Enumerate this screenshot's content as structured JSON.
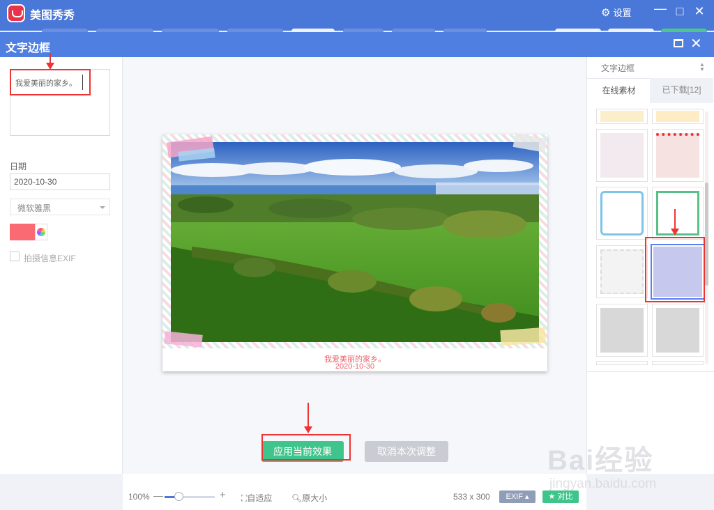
{
  "app": {
    "title": "美图秀秀",
    "settings_label": "设置"
  },
  "dialog": {
    "title": "文字边框"
  },
  "left_panel": {
    "text_value": "我爱美丽的家乡。",
    "date_label": "日期",
    "date_value": "2020-10-30",
    "font_value": "微软雅黑",
    "text_color": "#f96a73",
    "exif_checkbox_label": "拍摄信息EXIF"
  },
  "preview": {
    "caption_text": "我爱美丽的家乡。",
    "caption_date": "2020-10-30"
  },
  "actions": {
    "apply_label": "应用当前效果",
    "cancel_label": "取消本次调整"
  },
  "right_panel": {
    "category": "文字边框",
    "tabs": [
      {
        "label": "在线素材",
        "active": true
      },
      {
        "label": "已下载[12]",
        "active": false
      }
    ]
  },
  "bottom_bar": {
    "zoom": "100%",
    "fit_label": "自适应",
    "original_label": "原大小",
    "image_size": "533 x 300",
    "exif_label": "EXIF",
    "compare_label": "对比"
  },
  "watermark": {
    "brand": "Bai经验",
    "url": "jingyan.baidu.com"
  },
  "colors": {
    "titlebar": "#4a78d8",
    "dialog_header": "#4f7fe0",
    "apply": "#3fc58b",
    "cancel": "#c9ccd2",
    "annotation": "#e33333"
  }
}
